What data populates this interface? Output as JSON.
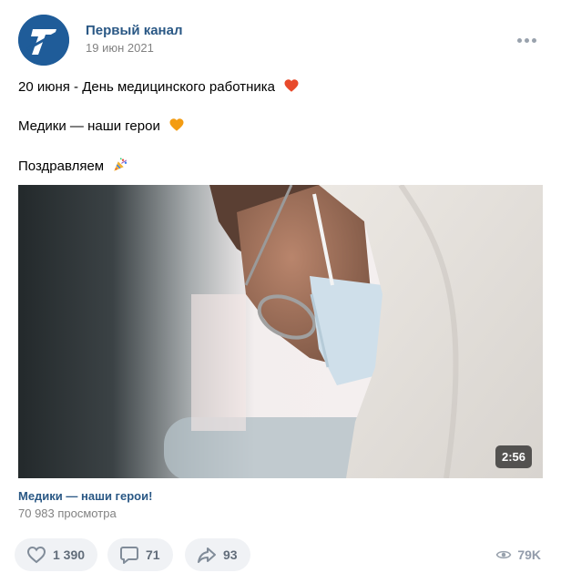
{
  "post": {
    "author": "Первый канал",
    "date": "19 июн 2021",
    "lines": [
      "20 июня - День медицинского работника",
      "Медики — наши герои",
      "Поздравляем"
    ],
    "emojis": [
      "red-heart-icon",
      "orange-heart-icon",
      "party-popper-icon"
    ]
  },
  "video": {
    "duration": "2:56",
    "title": "Медики — наши герои!",
    "views": "70 983 просмотра"
  },
  "actions": {
    "likes": "1 390",
    "comments": "71",
    "shares": "93",
    "views": "79K"
  },
  "colors": {
    "link": "#2a5885",
    "muted": "#828282",
    "button_bg": "#f0f2f5",
    "avatar": "#1f5c99"
  }
}
